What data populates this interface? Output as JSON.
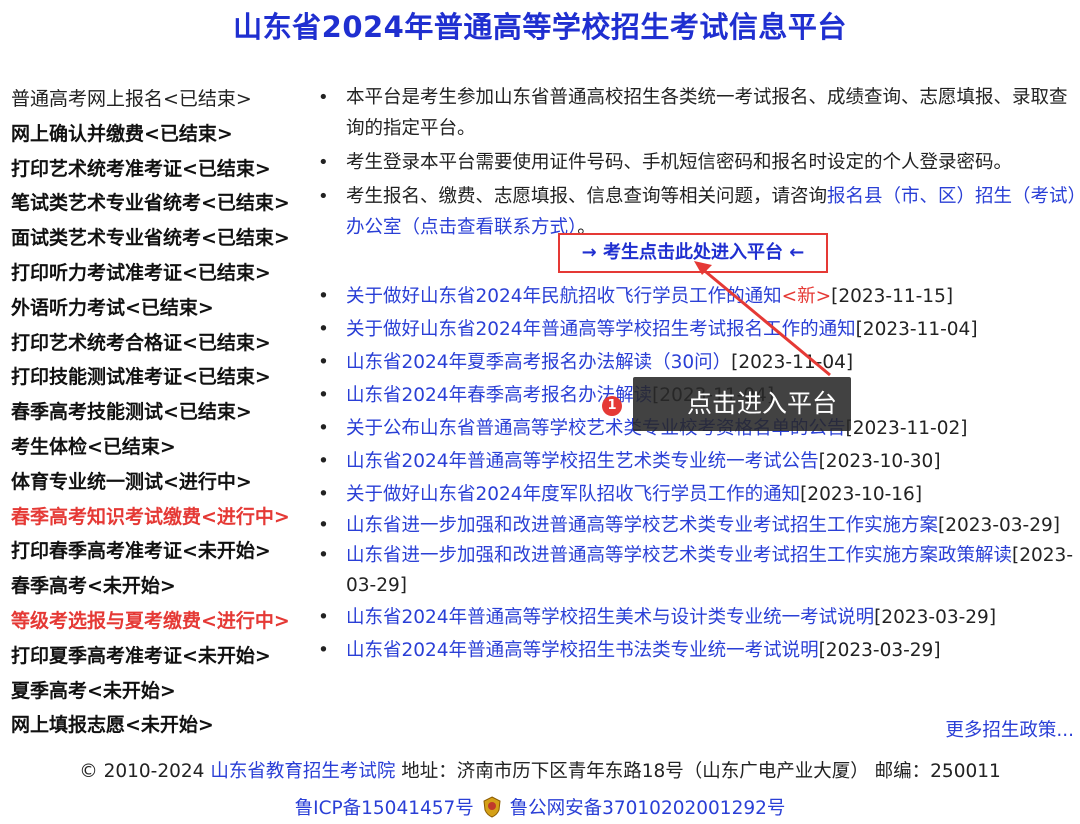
{
  "title": "山东省2024年普通高等学校招生考试信息平台",
  "nav": [
    {
      "label": "普通高考网上报名<已结束>",
      "style": "plain"
    },
    {
      "label": "网上确认并缴费<已结束>",
      "style": "bold"
    },
    {
      "label": "打印艺术统考准考证<已结束>",
      "style": "bold"
    },
    {
      "label": "笔试类艺术专业省统考<已结束>",
      "style": "bold"
    },
    {
      "label": "面试类艺术专业省统考<已结束>",
      "style": "bold"
    },
    {
      "label": "打印听力考试准考证<已结束>",
      "style": "bold"
    },
    {
      "label": "外语听力考试<已结束>",
      "style": "bold"
    },
    {
      "label": "打印艺术统考合格证<已结束>",
      "style": "bold"
    },
    {
      "label": "打印技能测试准考证<已结束>",
      "style": "bold"
    },
    {
      "label": "春季高考技能测试<已结束>",
      "style": "bold"
    },
    {
      "label": "考生体检<已结束>",
      "style": "bold"
    },
    {
      "label": "体育专业统一测试<进行中>",
      "style": "bold"
    },
    {
      "label": "春季高考知识考试缴费<进行中>",
      "style": "active"
    },
    {
      "label": "打印春季高考准考证<未开始>",
      "style": "bold"
    },
    {
      "label": "春季高考<未开始>",
      "style": "bold"
    },
    {
      "label": "等级考选报与夏考缴费<进行中>",
      "style": "active"
    },
    {
      "label": "打印夏季高考准考证<未开始>",
      "style": "bold"
    },
    {
      "label": "夏季高考<未开始>",
      "style": "bold"
    },
    {
      "label": "网上填报志愿<未开始>",
      "style": "bold"
    }
  ],
  "intro": {
    "p1": "本平台是考生参加山东省普通高校招生各类统一考试报名、成绩查询、志愿填报、录取查询的指定平台。",
    "p2": "考生登录本平台需要使用证件号码、手机短信密码和报名时设定的个人登录密码。",
    "p3_text": "考生报名、缴费、志愿填报、信息查询等相关问题，请咨询",
    "p3_link": "报名县（市、区）招生（考试）办公室（点击查看联系方式）",
    "p3_end": "。"
  },
  "enter_button": "→ 考生点击此处进入平台 ←",
  "news": [
    {
      "title": "关于做好山东省2024年民航招收飞行学员工作的通知",
      "flag": "<新>",
      "date": "[2023-11-15]"
    },
    {
      "title": "关于做好山东省2024年普通高等学校招生考试报名工作的通知",
      "flag": "",
      "date": "[2023-11-04]"
    },
    {
      "title": "山东省2024年夏季高考报名办法解读（30问）",
      "flag": "",
      "date": "[2023-11-04]"
    },
    {
      "title": "山东省2024年春季高考报名办法解读",
      "flag": "",
      "date": "[2023-11-04]"
    },
    {
      "title": "关于公布山东省普通高等学校艺术类专业校考资格名单的公告",
      "flag": "",
      "date": "[2023-11-02]"
    },
    {
      "title": "山东省2024年普通高等学校招生艺术类专业统一考试公告",
      "flag": "",
      "date": "[2023-10-30]"
    },
    {
      "title": "关于做好山东省2024年度军队招收飞行学员工作的通知",
      "flag": "",
      "date": "[2023-10-16]"
    },
    {
      "title": "山东省进一步加强和改进普通高等学校艺术类专业考试招生工作实施方案",
      "flag": "",
      "date": "[2023-03-29]"
    },
    {
      "title": "山东省进一步加强和改进普通高等学校艺术类专业考试招生工作实施方案政策解读",
      "flag": "",
      "date": "[2023-03-29]"
    },
    {
      "title": "山东省2024年普通高等学校招生美术与设计类专业统一考试说明",
      "flag": "",
      "date": "[2023-03-29]"
    },
    {
      "title": "山东省2024年普通高等学校招生书法类专业统一考试说明",
      "flag": "",
      "date": "[2023-03-29]"
    }
  ],
  "more_link": "更多招生政策...",
  "footer": {
    "copyright": "© 2010-2024",
    "org": "山东省教育招生考试院",
    "address": "地址：济南市历下区青年东路18号（山东广电产业大厦） 邮编：250011",
    "icp": "鲁ICP备15041457号",
    "police": "鲁公网安备37010202001292号"
  },
  "annotation": {
    "marker": "1",
    "tooltip": "点击进入平台"
  },
  "colors": {
    "title": "#1f2fd0",
    "link": "#2a3fd6",
    "active": "#e53935"
  }
}
